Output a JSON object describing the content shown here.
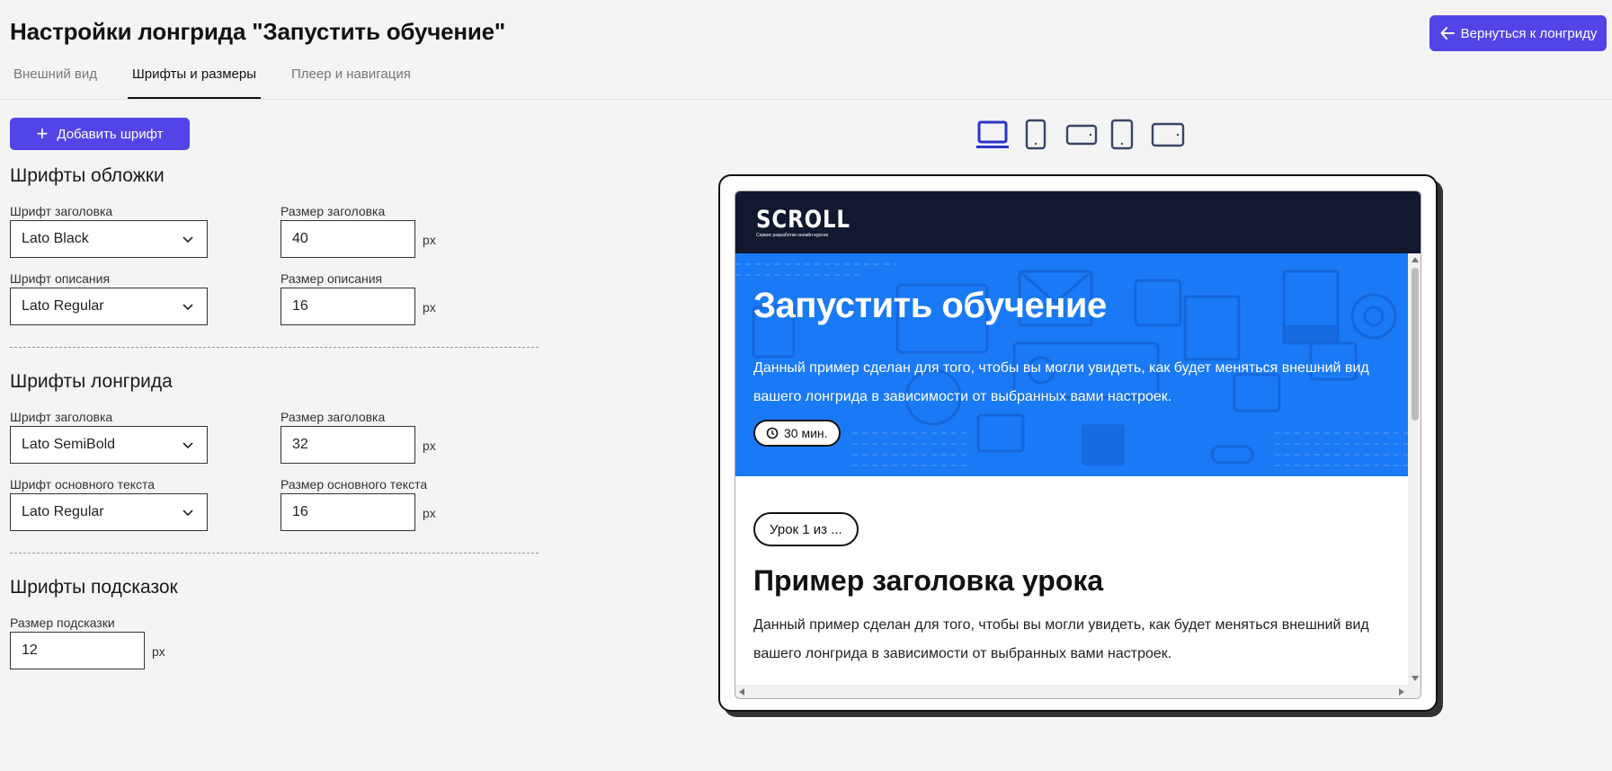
{
  "page": {
    "title": "Настройки лонгрида \"Запустить обучение\"",
    "back_button": "Вернуться к лонгриду"
  },
  "tabs": [
    {
      "label": "Внешний вид",
      "active": false
    },
    {
      "label": "Шрифты и размеры",
      "active": true
    },
    {
      "label": "Плеер и навигация",
      "active": false
    }
  ],
  "add_font_button": "Добавить шрифт",
  "cover_fonts": {
    "title": "Шрифты обложки",
    "heading_font_label": "Шрифт заголовка",
    "heading_font_value": "Lato Black",
    "heading_size_label": "Размер заголовка",
    "heading_size_value": "40",
    "desc_font_label": "Шрифт описания",
    "desc_font_value": "Lato Regular",
    "desc_size_label": "Размер описания",
    "desc_size_value": "16",
    "unit": "px"
  },
  "longread_fonts": {
    "title": "Шрифты лонгрида",
    "heading_font_label": "Шрифт заголовка",
    "heading_font_value": "Lato SemiBold",
    "heading_size_label": "Размер заголовка",
    "heading_size_value": "32",
    "body_font_label": "Шрифт основного текста",
    "body_font_value": "Lato Regular",
    "body_size_label": "Размер основного текста",
    "body_size_value": "16",
    "unit": "px"
  },
  "hint_fonts": {
    "title": "Шрифты подсказок",
    "hint_size_label": "Размер подсказки",
    "hint_size_value": "12",
    "unit": "px"
  },
  "devices": [
    "laptop-icon",
    "phone-portrait-icon",
    "phone-landscape-icon",
    "tablet-portrait-icon",
    "tablet-landscape-icon"
  ],
  "preview": {
    "logo": "SCROLL",
    "logo_sub": "Сервис разработки онлайн-курсов",
    "hero_title": "Запустить обучение",
    "hero_desc": "Данный пример сделан для того, чтобы вы могли увидеть, как будет меняться внешний вид вашего лонгрида в зависимости от выбранных вами настроек.",
    "duration": "30 мин.",
    "lesson_badge": "Урок 1 из ...",
    "lesson_title": "Пример заголовка урока",
    "lesson_text": "Данный пример сделан для того, чтобы вы могли увидеть, как будет меняться внешний вид вашего лонгрида в зависимости от выбранных вами настроек."
  },
  "colors": {
    "accent": "#5244e6",
    "hero_bg": "#1a7af5",
    "header_bg": "#111830",
    "active_device": "#2a35c9",
    "device": "#3a4568"
  }
}
